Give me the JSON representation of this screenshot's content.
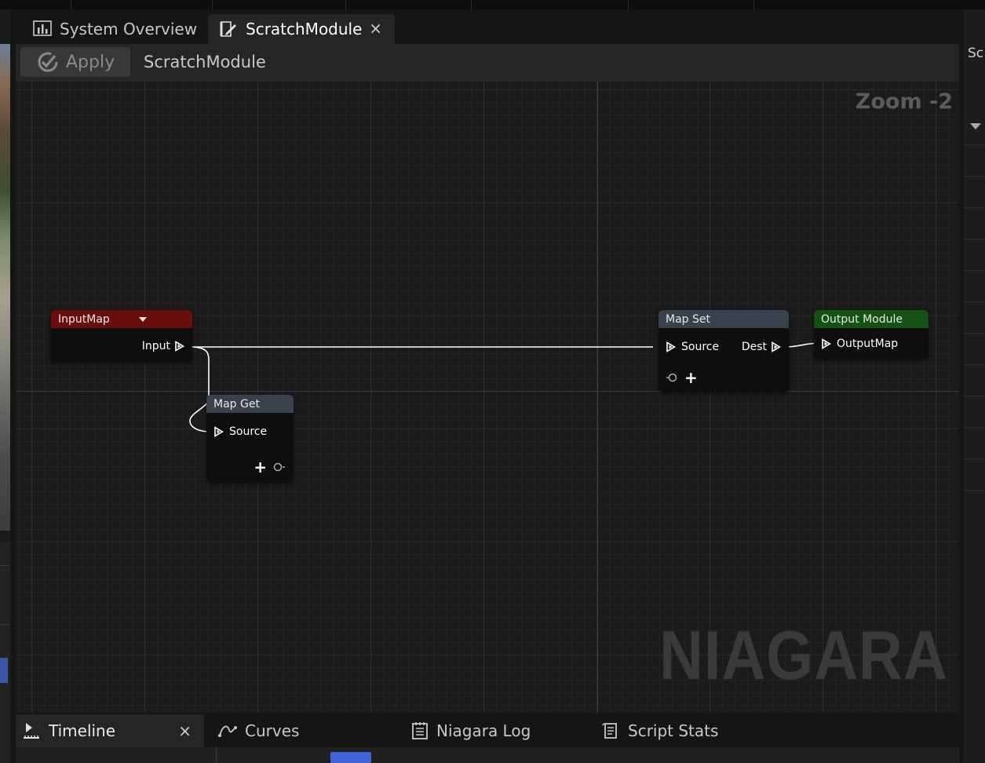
{
  "tabs": {
    "overview": {
      "label": "System Overview",
      "icon": "chart-icon"
    },
    "scratch": {
      "label": "ScratchModule",
      "icon": "script-edit-icon",
      "close": "×"
    }
  },
  "toolbar": {
    "apply_label": "Apply",
    "title": "ScratchModule"
  },
  "graph": {
    "zoom_label": "Zoom -2",
    "watermark": "NIAGARA",
    "nodes": {
      "input_map": {
        "title": "InputMap",
        "pin_input": "Input",
        "color": "#6a0d0d"
      },
      "map_get": {
        "title": "Map Get",
        "pin_source": "Source",
        "add": "+",
        "color": "#39414d"
      },
      "map_set": {
        "title": "Map Set",
        "pin_source": "Source",
        "pin_dest": "Dest",
        "add": "+",
        "color": "#39414d"
      },
      "output_module": {
        "title": "Output Module",
        "pin_output_map": "OutputMap",
        "color": "#135213"
      }
    }
  },
  "bottom_tabs": {
    "timeline": {
      "label": "Timeline",
      "close": "×",
      "icon": "timeline-icon"
    },
    "curves": {
      "label": "Curves",
      "icon": "curves-icon"
    },
    "log": {
      "label": "Niagara Log",
      "icon": "log-icon"
    },
    "stats": {
      "label": "Script Stats",
      "icon": "stats-icon"
    }
  },
  "right_panel": {
    "label": "Sc"
  }
}
